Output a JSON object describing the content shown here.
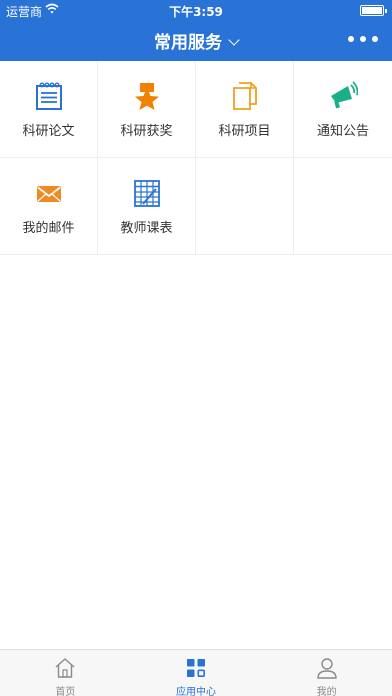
{
  "status_bar": {
    "carrier": "运营商",
    "time": "下午3:59",
    "battery_level": 1.0
  },
  "navbar": {
    "title": "常用服务"
  },
  "services": [
    {
      "label": "科研论文",
      "icon": "notebook-icon",
      "color": "#2a73d6"
    },
    {
      "label": "科研获奖",
      "icon": "award-icon",
      "color": "#f08200"
    },
    {
      "label": "科研项目",
      "icon": "documents-icon",
      "color": "#f0a020"
    },
    {
      "label": "通知公告",
      "icon": "megaphone-icon",
      "color": "#1aaf8a"
    },
    {
      "label": "我的邮件",
      "icon": "mail-icon",
      "color": "#f08a24"
    },
    {
      "label": "教师课表",
      "icon": "timetable-icon",
      "color": "#2a73d6"
    }
  ],
  "tabbar": {
    "items": [
      {
        "label": "首页",
        "icon": "home-icon",
        "active": false
      },
      {
        "label": "应用中心",
        "icon": "apps-grid-icon",
        "active": true
      },
      {
        "label": "我的",
        "icon": "user-icon",
        "active": false
      }
    ],
    "active_color": "#2a73d6",
    "inactive_color": "#8a8a8a"
  },
  "theme": {
    "header_bg": "#2a73d6"
  }
}
